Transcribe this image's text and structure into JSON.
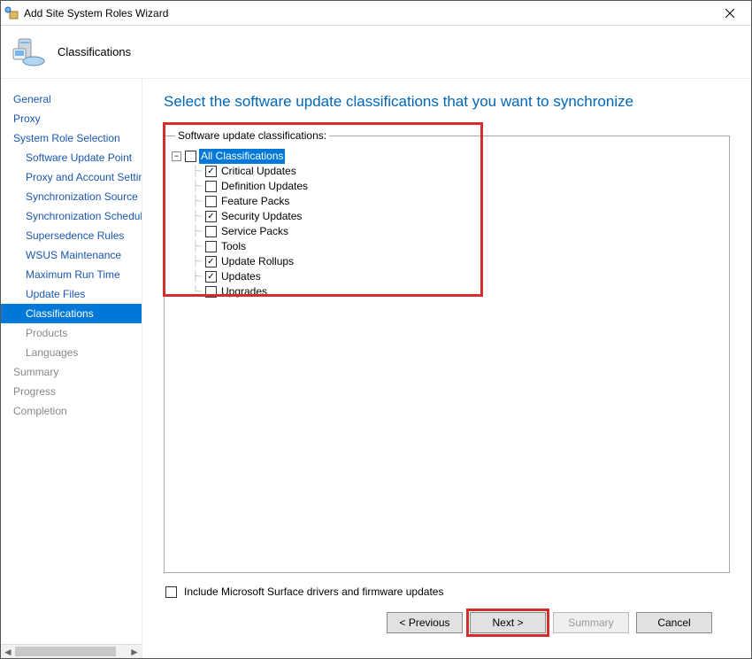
{
  "window": {
    "title": "Add Site System Roles Wizard"
  },
  "header": {
    "page_name": "Classifications"
  },
  "nav": {
    "items": [
      {
        "label": "General",
        "sub": false,
        "state": "link"
      },
      {
        "label": "Proxy",
        "sub": false,
        "state": "link"
      },
      {
        "label": "System Role Selection",
        "sub": false,
        "state": "link"
      },
      {
        "label": "Software Update Point",
        "sub": true,
        "state": "link"
      },
      {
        "label": "Proxy and Account Settings",
        "sub": true,
        "state": "link"
      },
      {
        "label": "Synchronization Source",
        "sub": true,
        "state": "link"
      },
      {
        "label": "Synchronization Schedule",
        "sub": true,
        "state": "link"
      },
      {
        "label": "Supersedence Rules",
        "sub": true,
        "state": "link"
      },
      {
        "label": "WSUS Maintenance",
        "sub": true,
        "state": "link"
      },
      {
        "label": "Maximum Run Time",
        "sub": true,
        "state": "link"
      },
      {
        "label": "Update Files",
        "sub": true,
        "state": "link"
      },
      {
        "label": "Classifications",
        "sub": true,
        "state": "selected"
      },
      {
        "label": "Products",
        "sub": true,
        "state": "muted"
      },
      {
        "label": "Languages",
        "sub": true,
        "state": "muted"
      },
      {
        "label": "Summary",
        "sub": false,
        "state": "muted"
      },
      {
        "label": "Progress",
        "sub": false,
        "state": "muted"
      },
      {
        "label": "Completion",
        "sub": false,
        "state": "muted"
      }
    ]
  },
  "main": {
    "heading": "Select the software update classifications that you want to synchronize",
    "group_label": "Software update classifications:",
    "tree": {
      "root": {
        "label": "All Classifications",
        "checked": false,
        "selected": true
      },
      "children": [
        {
          "label": "Critical Updates",
          "checked": true
        },
        {
          "label": "Definition Updates",
          "checked": false
        },
        {
          "label": "Feature Packs",
          "checked": false
        },
        {
          "label": "Security Updates",
          "checked": true
        },
        {
          "label": "Service Packs",
          "checked": false
        },
        {
          "label": "Tools",
          "checked": false
        },
        {
          "label": "Update Rollups",
          "checked": true
        },
        {
          "label": "Updates",
          "checked": true
        },
        {
          "label": "Upgrades",
          "checked": false
        }
      ]
    },
    "include_surface": {
      "label": "Include Microsoft Surface drivers and firmware updates",
      "checked": false
    }
  },
  "footer": {
    "previous": "< Previous",
    "next": "Next >",
    "summary": "Summary",
    "cancel": "Cancel"
  }
}
